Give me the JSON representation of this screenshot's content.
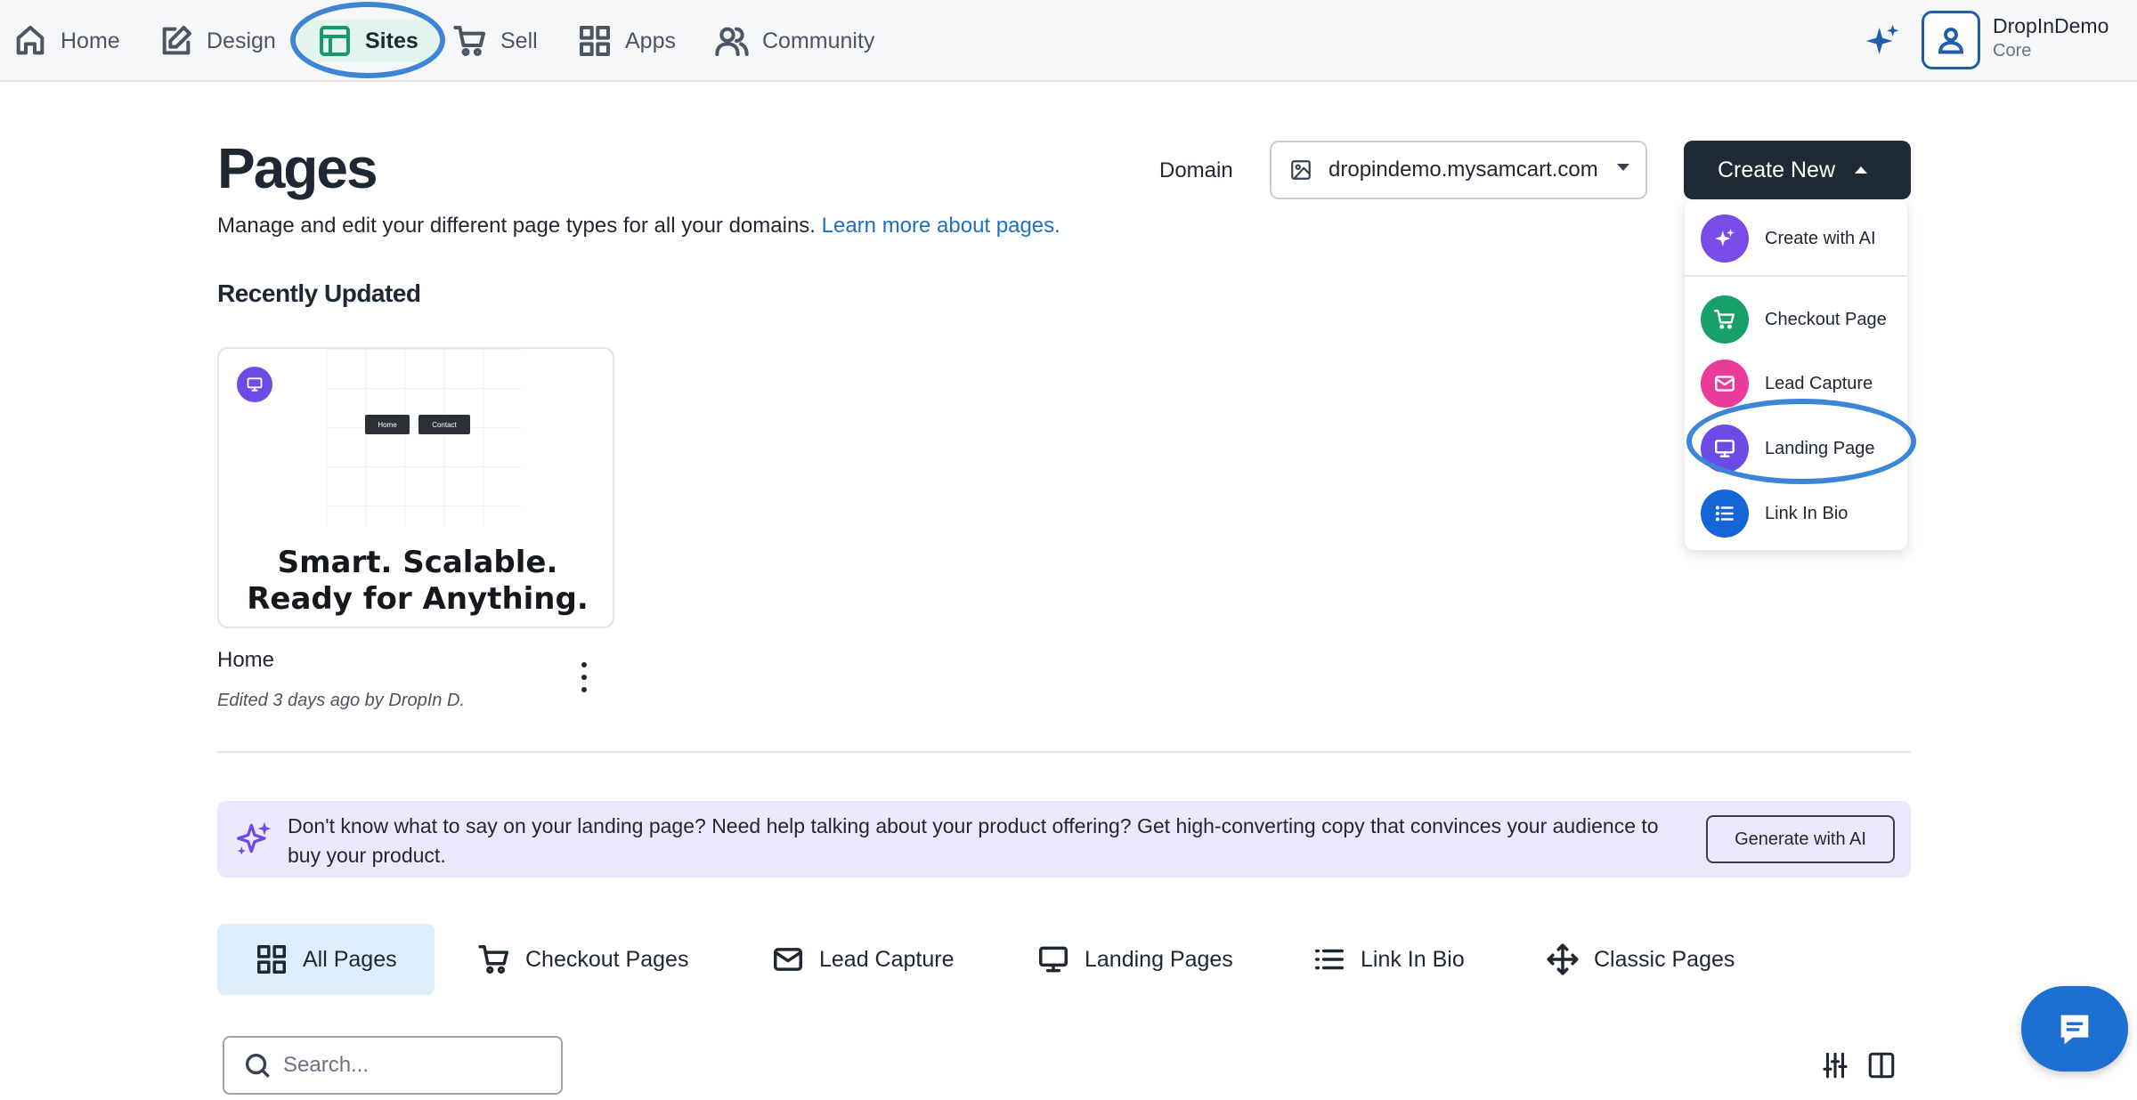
{
  "nav": {
    "items": [
      {
        "label": "Home",
        "icon": "home-icon"
      },
      {
        "label": "Design",
        "icon": "pencil-square-icon"
      },
      {
        "label": "Sites",
        "icon": "layout-icon"
      },
      {
        "label": "Sell",
        "icon": "cart-icon"
      },
      {
        "label": "Apps",
        "icon": "grid-icon"
      },
      {
        "label": "Community",
        "icon": "users-icon"
      }
    ],
    "active": "Sites",
    "user": {
      "name": "DropInDemo",
      "plan": "Core"
    }
  },
  "header": {
    "title": "Pages",
    "description": "Manage and edit your different page types for all your domains.",
    "learn_more": "Learn more about pages.",
    "domain_label": "Domain",
    "domain_value": "dropindemo.mysamcart.com",
    "create_button": "Create New"
  },
  "create_menu": {
    "items": [
      {
        "label": "Create with AI",
        "icon": "sparkle-icon",
        "color": "#7b4de8"
      },
      {
        "label": "Checkout Page",
        "icon": "cart-icon",
        "color": "#17a06a"
      },
      {
        "label": "Lead Capture",
        "icon": "mail-icon",
        "color": "#e93b9a"
      },
      {
        "label": "Landing Page",
        "icon": "monitor-icon",
        "color": "#6d4ce6"
      },
      {
        "label": "Link In Bio",
        "icon": "list-icon",
        "color": "#1565d8"
      }
    ]
  },
  "recent": {
    "title": "Recently Updated",
    "card": {
      "preview_buttons": [
        "Home",
        "Contact"
      ],
      "headline_line1": "Smart. Scalable.",
      "headline_line2": "Ready for Anything.",
      "name": "Home",
      "meta": "Edited 3 days ago by DropIn D."
    }
  },
  "ai_banner": {
    "text": "Don't know what to say on your landing page? Need help talking about your product offering? Get high-converting copy that convinces your audience to buy your product.",
    "button": "Generate with AI"
  },
  "tabs": [
    {
      "label": "All Pages",
      "icon": "grid-icon"
    },
    {
      "label": "Checkout Pages",
      "icon": "cart-icon"
    },
    {
      "label": "Lead Capture",
      "icon": "mail-icon"
    },
    {
      "label": "Landing Pages",
      "icon": "monitor-icon"
    },
    {
      "label": "Link In Bio",
      "icon": "list-icon"
    },
    {
      "label": "Classic Pages",
      "icon": "move-icon"
    }
  ],
  "search": {
    "placeholder": "Search..."
  },
  "colors": {
    "accent": "#1f2a37",
    "active_nav": "#159a6c",
    "link": "#1f6fc2",
    "highlight_ring": "#3d86d6"
  }
}
